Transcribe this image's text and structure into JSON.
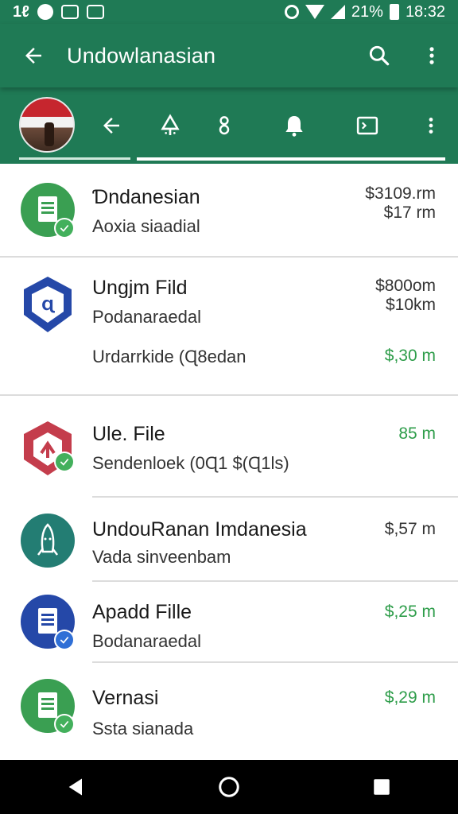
{
  "status_bar": {
    "left_text": "1ℓ",
    "battery_text": "21%",
    "time": "18:32"
  },
  "app_bar": {
    "title": "Undowlanasian",
    "back_icon": "arrow-back-icon",
    "search_icon": "search-icon",
    "menu_icon": "more-vert-icon"
  },
  "tab_bar": {
    "icons": [
      "avatar",
      "arrow-back-icon",
      "tree-icon",
      "hook-icon",
      "bell-icon",
      "terminal-icon",
      "more-vert-icon"
    ]
  },
  "colors": {
    "primary": "#1f7a55",
    "accent_green": "#2e9d4a",
    "icon_green": "#3a9f52",
    "icon_blue": "#2548a8",
    "icon_red": "#c43d4c",
    "icon_teal": "#237d73"
  },
  "items": [
    {
      "title": "Ɗndanesian",
      "subtitle": "Aoxia siaadial",
      "amount1": "$3109.rm",
      "amount2": "$17 rm",
      "icon": "document-icon"
    },
    {
      "title": "Ungjm Fild",
      "subtitle": "Podanaraedal",
      "extra": "Urdarrkide (Ɋ8edan",
      "amount1": "$800om",
      "amount2": "$10km",
      "amount3": "$,30 m",
      "icon": "shield-icon"
    },
    {
      "title": "Ule. File",
      "subtitle": "Sendenloek (0Ɋ1 $(Ɋ1ls)",
      "amount1": "85 m",
      "icon": "upload-shield-icon"
    },
    {
      "title": "UndouRanan Imdanesia",
      "subtitle": "Vada sinveenbam",
      "amount1": "$,57 m",
      "icon": "rocket-icon"
    },
    {
      "title": "Apadd Fille",
      "subtitle": "Bodanaraedal",
      "amount1": "$,25 m",
      "icon": "document-icon"
    },
    {
      "title": "Vernasi",
      "subtitle": "Ssta sianada",
      "amount1": "$,29 m",
      "icon": "document-icon"
    }
  ],
  "nav_bar": {
    "back": "nav-back-icon",
    "home": "nav-home-icon",
    "recents": "nav-recents-icon"
  }
}
